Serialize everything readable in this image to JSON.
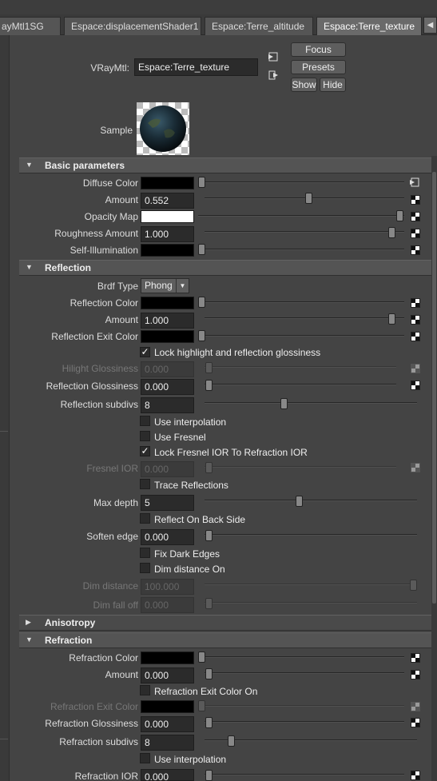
{
  "tabs": [
    {
      "label": "ayMtl1SG",
      "active": false
    },
    {
      "label": "Espace:displacementShader1",
      "active": false
    },
    {
      "label": "Espace:Terre_altitude",
      "active": false
    },
    {
      "label": "Espace:Terre_texture",
      "active": true
    }
  ],
  "tab_scroll_icon": "triangle-left-icon",
  "header": {
    "type_label": "VRayMtl:",
    "name_value": "Espace:Terre_texture",
    "focus": "Focus",
    "presets": "Presets",
    "show": "Show",
    "hide": "Hide",
    "sample_label": "Sample"
  },
  "sections": {
    "basic": "Basic parameters",
    "reflection": "Reflection",
    "anisotropy": "Anisotropy",
    "refraction": "Refraction"
  },
  "basic": {
    "diffuse_color": {
      "label": "Diffuse Color",
      "color": "#000000",
      "level": 0.0
    },
    "amount": {
      "label": "Amount",
      "value": "0.552",
      "level": 0.552
    },
    "opacity_map": {
      "label": "Opacity Map",
      "color": "#ffffff",
      "level": 1.0
    },
    "roughness_amount": {
      "label": "Roughness Amount",
      "value": "1.000",
      "level": 1.0
    },
    "self_illumination": {
      "label": "Self-Illumination",
      "color": "#000000",
      "level": 0.0
    }
  },
  "reflection": {
    "brdf_type": {
      "label": "Brdf Type",
      "value": "Phong"
    },
    "reflection_color": {
      "label": "Reflection Color",
      "color": "#000000",
      "level": 0.0
    },
    "amount": {
      "label": "Amount",
      "value": "1.000",
      "level": 1.0
    },
    "exit_color": {
      "label": "Reflection Exit Color",
      "color": "#000000",
      "level": 0.0
    },
    "lock_highlight": {
      "label": "Lock highlight and reflection glossiness",
      "checked": true
    },
    "hilight_glossiness": {
      "label": "Hilight Glossiness",
      "value": "0.000",
      "level": 0.0
    },
    "reflection_glossiness": {
      "label": "Reflection Glossiness",
      "value": "0.000",
      "level": 0.0
    },
    "reflection_subdivs": {
      "label": "Reflection subdivs",
      "value": "8",
      "level": 0.32
    },
    "use_interpolation": {
      "label": "Use interpolation",
      "checked": false
    },
    "use_fresnel": {
      "label": "Use Fresnel",
      "checked": false
    },
    "lock_fresnel_ior": {
      "label": "Lock Fresnel IOR To Refraction IOR",
      "checked": true
    },
    "fresnel_ior": {
      "label": "Fresnel IOR",
      "value": "0.000",
      "level": 0.0
    },
    "trace_reflections": {
      "label": "Trace Reflections",
      "checked": false
    },
    "max_depth": {
      "label": "Max depth",
      "value": "5",
      "level": 0.43
    },
    "reflect_back_side": {
      "label": "Reflect On Back Side",
      "checked": false
    },
    "soften_edge": {
      "label": "Soften edge",
      "value": "0.000",
      "level": 0.0
    },
    "fix_dark_edges": {
      "label": "Fix Dark Edges",
      "checked": false
    },
    "dim_distance_on": {
      "label": "Dim distance On",
      "checked": false
    },
    "dim_distance": {
      "label": "Dim distance",
      "value": "100.000",
      "level": 1.0
    },
    "dim_fall_off": {
      "label": "Dim fall off",
      "value": "0.000",
      "level": 0.0
    }
  },
  "refraction": {
    "refraction_color": {
      "label": "Refraction Color",
      "color": "#000000",
      "level": 0.0
    },
    "amount": {
      "label": "Amount",
      "value": "0.000",
      "level": 0.0
    },
    "exit_color_on": {
      "label": "Refraction Exit Color On",
      "checked": false
    },
    "exit_color": {
      "label": "Refraction Exit Color",
      "color": "#000000",
      "level": 0.0
    },
    "refraction_glossiness": {
      "label": "Refraction Glossiness",
      "value": "0.000",
      "level": 0.0
    },
    "refraction_subdivs": {
      "label": "Refraction subdivs",
      "value": "8",
      "level": 0.1
    },
    "use_interpolation": {
      "label": "Use interpolation",
      "checked": false
    },
    "refraction_ior": {
      "label": "Refraction IOR",
      "value": "0.000",
      "level": 0.0
    }
  }
}
